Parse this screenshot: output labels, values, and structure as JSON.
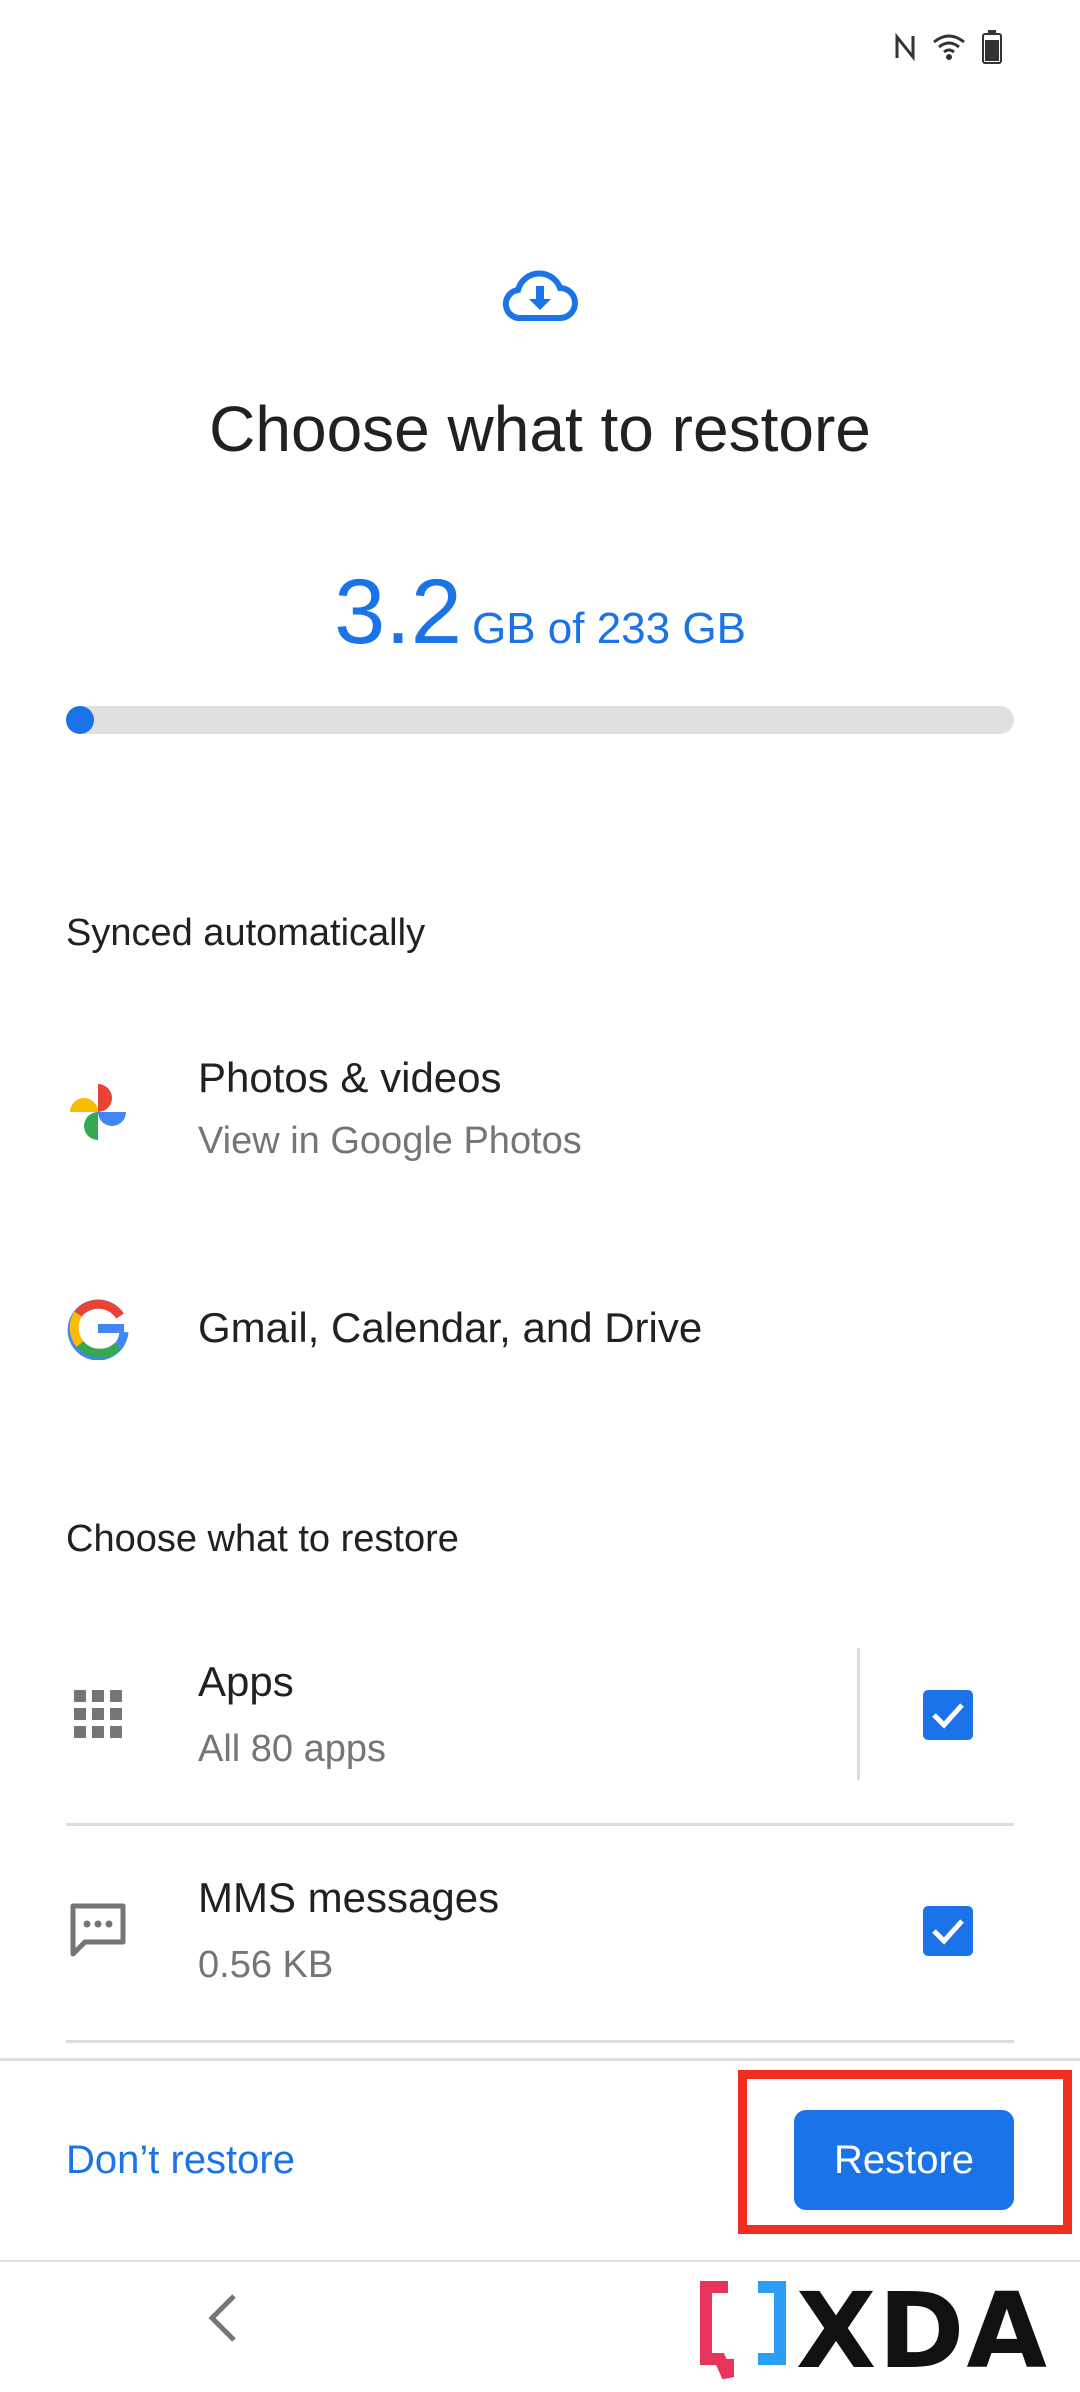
{
  "status_bar": {
    "icons": [
      "nfc-icon",
      "wifi-icon",
      "battery-icon"
    ]
  },
  "header": {
    "icon": "cloud-download-icon",
    "title": "Choose what to restore"
  },
  "storage": {
    "used": "3.2",
    "total_text": "GB of 233 GB",
    "progress_fraction": 0.014,
    "accent_color": "#1a73e8"
  },
  "synced_section": {
    "label": "Synced automatically",
    "items": [
      {
        "icon": "google-photos-icon",
        "title": "Photos & videos",
        "subtitle": "View in Google Photos"
      },
      {
        "icon": "google-g-icon",
        "title": "Gmail, Calendar, and Drive"
      }
    ]
  },
  "restore_section": {
    "label": "Choose what to restore",
    "items": [
      {
        "icon": "apps-grid-icon",
        "title": "Apps",
        "subtitle": "All 80 apps",
        "checked": true
      },
      {
        "icon": "message-icon",
        "title": "MMS messages",
        "subtitle": "0.56 KB",
        "checked": true
      }
    ]
  },
  "footer": {
    "dont_restore_label": "Don’t restore",
    "restore_label": "Restore",
    "highlight_color": "#f02d1e"
  },
  "nav": {
    "back_icon": "back-chevron-icon"
  },
  "watermark": {
    "text": "XDA"
  }
}
